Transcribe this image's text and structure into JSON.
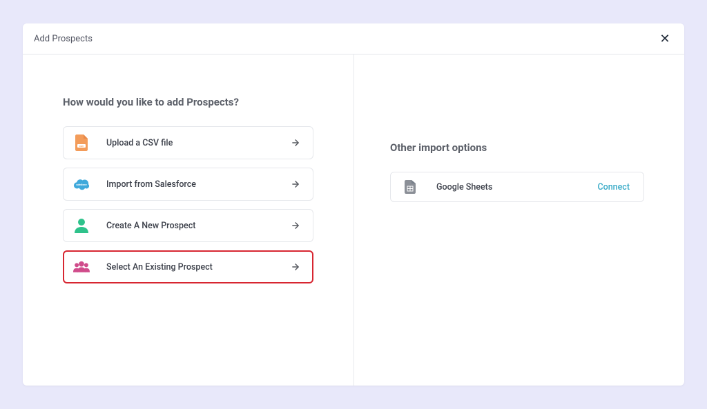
{
  "modal": {
    "title": "Add Prospects",
    "close": "✕"
  },
  "main": {
    "heading": "How would you like to add Prospects?",
    "options": [
      {
        "label": "Upload a CSV file"
      },
      {
        "label": "Import from Salesforce"
      },
      {
        "label": "Create A New Prospect"
      },
      {
        "label": "Select An Existing Prospect"
      }
    ]
  },
  "other": {
    "heading": "Other import options",
    "items": [
      {
        "label": "Google Sheets",
        "action": "Connect"
      }
    ]
  },
  "colors": {
    "csv_icon": "#F39C5A",
    "salesforce_icon": "#3FA9DB",
    "user_icon": "#2EC28B",
    "group_icon": "#D04C8B",
    "sheets_icon": "#8B8F97",
    "highlight_border": "#D72631",
    "connect_link": "#37AAC7"
  }
}
